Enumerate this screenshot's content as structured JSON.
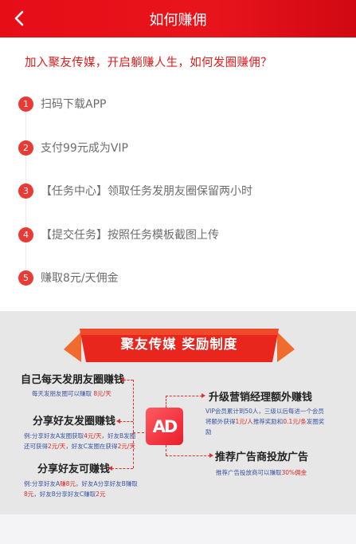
{
  "header": {
    "title": "如何赚佣"
  },
  "headline": "加入聚友传媒，开启躺赚人生，如何发圈赚佣？",
  "steps": [
    {
      "num": "1",
      "label": "扫码下载APP"
    },
    {
      "num": "2",
      "label": "支付99元成为VIP"
    },
    {
      "num": "3",
      "label": "【任务中心】领取任务发朋友圈保留两小时"
    },
    {
      "num": "4",
      "label": "【提交任务】按照任务模板截图上传"
    },
    {
      "num": "5",
      "label": "赚取8元/天佣金"
    }
  ],
  "promo": {
    "banner": "聚友传媒 奖励制度",
    "logo": "AD",
    "left": [
      {
        "title": "自己每天发朋友圈赚钱",
        "desc_a": "每天发朋友圈可以赚取 ",
        "desc_r": "8元/天"
      },
      {
        "title": "分享好友发圈赚钱",
        "line1_a": "例:分享好友A发圈获取",
        "line1_r": "4元/天",
        "line1_b": "，好友B发圈",
        "line2_a": "还可获得",
        "line2_r": "2元/天",
        "line2_b": "，好友C发圈在获得",
        "line2_r2": "2元/天"
      },
      {
        "title": "分享好友可赚钱",
        "line1_a": "例:分享好友A",
        "line1_r": "赚8元",
        "line1_b": "，好友A分享好友B赚取",
        "line2_r": "8元",
        "line2_b": "，好友B分享好友C赚取",
        "line2_r2": "2元"
      }
    ],
    "right": [
      {
        "title": "升级营销经理额外赚钱",
        "line1": "VIP会员累计到50人，三级以后每进一个会员",
        "line2_a": "将额外获得",
        "line2_r": "1元/人",
        "line2_b": "推荐奖励和",
        "line2_r2": "0.1元/条",
        "line2_c": "发圈奖",
        "line3": "励"
      },
      {
        "title": "推荐广告商投放广告",
        "desc_a": "推荐广告投放商可以赚取",
        "desc_r": "30%佣金"
      }
    ]
  }
}
